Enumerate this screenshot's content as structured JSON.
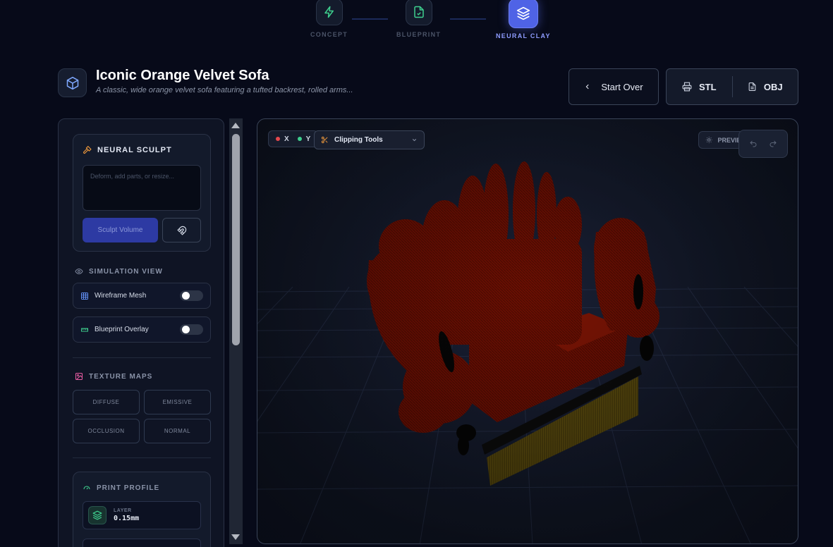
{
  "stepper": {
    "steps": [
      {
        "label": "CONCEPT",
        "icon": "zap-icon",
        "state": "done"
      },
      {
        "label": "BLUEPRINT",
        "icon": "file-check-icon",
        "state": "done"
      },
      {
        "label": "NEURAL CLAY",
        "icon": "layers-icon",
        "state": "active"
      }
    ]
  },
  "header": {
    "icon": "cube-icon",
    "title": "Iconic Orange Velvet Sofa",
    "subtitle": "A classic, wide orange velvet sofa featuring a tufted backrest, rolled arms...",
    "start_over_label": "Start Over",
    "export": {
      "stl_label": "STL",
      "obj_label": "OBJ"
    }
  },
  "sidebar": {
    "sculpt": {
      "title": "NEURAL SCULPT",
      "placeholder": "Deform, add parts, or resize...",
      "button_label": "Sculpt Volume"
    },
    "simulation": {
      "title": "SIMULATION VIEW",
      "wireframe_label": "Wireframe Mesh",
      "wireframe_on": false,
      "blueprint_label": "Blueprint Overlay",
      "blueprint_on": false
    },
    "texture": {
      "title": "TEXTURE MAPS",
      "maps": [
        "DIFFUSE",
        "EMISSIVE",
        "OCCLUSION",
        "NORMAL"
      ]
    },
    "print": {
      "title": "PRINT PROFILE",
      "layer_label": "LAYER",
      "layer_value": "0.15mm"
    }
  },
  "viewport": {
    "axes": {
      "x": "X",
      "y": "Y"
    },
    "clipping_label": "Clipping Tools",
    "preview_label": "PREVIEW",
    "colors": {
      "sofa": "#6b0f02",
      "base_bar": "#0b0b0b",
      "legs": "#5a4a0d",
      "grid": "#2b3550"
    }
  },
  "colors": {
    "accent": "#4f63e6",
    "background": "#070a19"
  }
}
